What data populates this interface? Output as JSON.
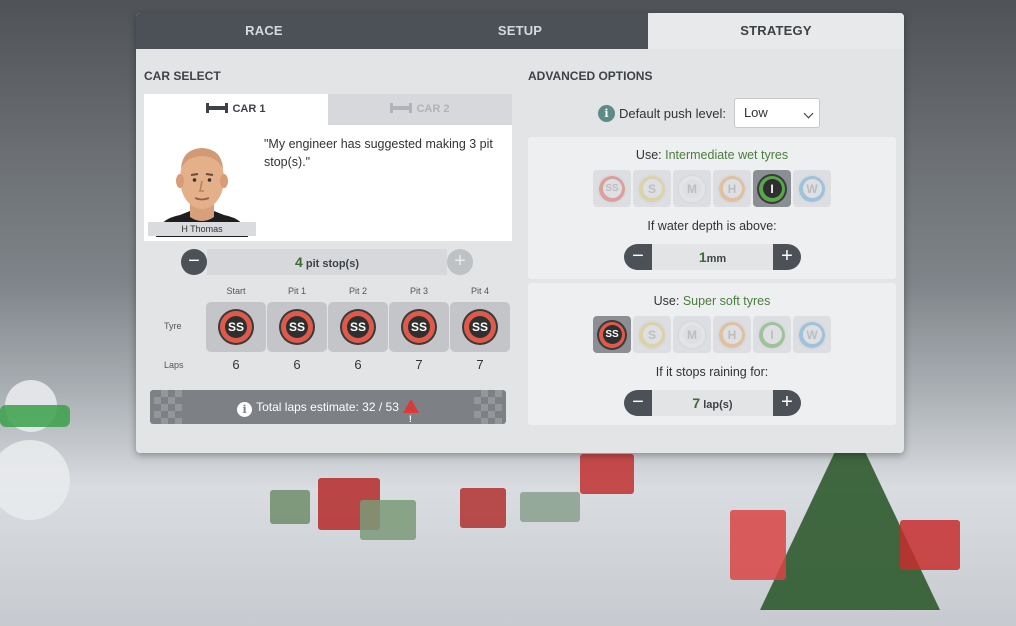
{
  "tabs": [
    "RACE",
    "SETUP",
    "STRATEGY"
  ],
  "active_tab": "STRATEGY",
  "car_select": {
    "title": "CAR SELECT",
    "cars": [
      "CAR 1",
      "CAR 2"
    ],
    "active_car": "CAR 1",
    "driver": {
      "name": "H Thomas",
      "quote": "\"My engineer has suggested making 3 pit stop(s).\""
    },
    "pit_stops": {
      "count": "4",
      "unit": "pit stop(s)"
    },
    "stints": {
      "columns": [
        "Start",
        "Pit 1",
        "Pit 2",
        "Pit 3",
        "Pit 4"
      ],
      "row_labels": {
        "tyre": "Tyre",
        "laps": "Laps"
      },
      "tyres": [
        "SS",
        "SS",
        "SS",
        "SS",
        "SS"
      ],
      "laps": [
        "6",
        "6",
        "6",
        "7",
        "7"
      ]
    },
    "estimate": {
      "label": "Total laps estimate:",
      "value": "32 / 53",
      "warning": true
    }
  },
  "advanced": {
    "title": "ADVANCED OPTIONS",
    "push_level": {
      "label": "Default push level:",
      "value": "Low"
    },
    "wet_rule": {
      "use_label": "Use:",
      "use_value": "Intermediate wet tyres",
      "selected_tyre": "I",
      "condition": "If water depth is above:",
      "amount": "1",
      "unit": "mm"
    },
    "dry_rule": {
      "use_label": "Use:",
      "use_value": "Super soft tyres",
      "selected_tyre": "SS",
      "condition": "If it stops raining for:",
      "amount": "7",
      "unit": "lap(s)"
    },
    "tyre_options": [
      "SS",
      "S",
      "M",
      "H",
      "I",
      "W"
    ]
  },
  "colors": {
    "tab_bg": "#4b5157",
    "panel_bg": "#e3e4e6",
    "accent_green": "#4b7d3c",
    "tyre_SS": "#e05a4c",
    "tyre_S": "#e3c96a",
    "tyre_M": "#f2f2f2",
    "tyre_H": "#e8a35a",
    "tyre_I": "#58a84a",
    "tyre_W": "#5aa6d8"
  },
  "icons": [
    "info-icon",
    "warning-icon",
    "car-icon",
    "minus-icon",
    "plus-icon",
    "chevron-down-icon"
  ]
}
